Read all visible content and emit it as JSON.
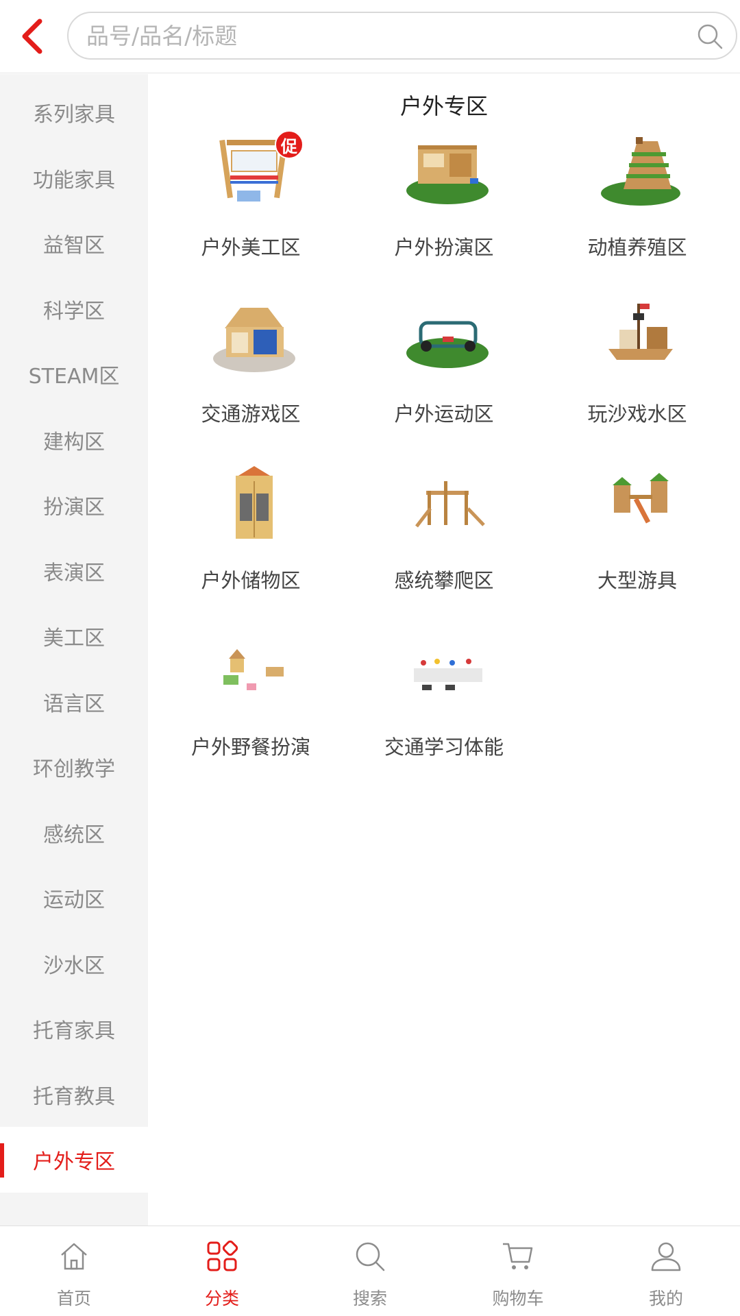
{
  "header": {
    "search_placeholder": "品号/品名/标题"
  },
  "sidebar": {
    "items": [
      {
        "label": "系列家具"
      },
      {
        "label": "功能家具"
      },
      {
        "label": "益智区"
      },
      {
        "label": "科学区"
      },
      {
        "label": "STEAM区"
      },
      {
        "label": "建构区"
      },
      {
        "label": "扮演区"
      },
      {
        "label": "表演区"
      },
      {
        "label": "美工区"
      },
      {
        "label": "语言区"
      },
      {
        "label": "环创教学"
      },
      {
        "label": "感统区"
      },
      {
        "label": "运动区"
      },
      {
        "label": "沙水区"
      },
      {
        "label": "托育家具"
      },
      {
        "label": "托育教具"
      },
      {
        "label": "户外专区"
      }
    ],
    "active_label": "户外专区"
  },
  "main": {
    "section_title": "户外专区",
    "promo_badge": "促",
    "categories": [
      {
        "label": "户外美工区",
        "icon": "outdoor-art-easel"
      },
      {
        "label": "户外扮演区",
        "icon": "outdoor-kitchen"
      },
      {
        "label": "动植养殖区",
        "icon": "planting-tower"
      },
      {
        "label": "交通游戏区",
        "icon": "traffic-house"
      },
      {
        "label": "户外运动区",
        "icon": "car-frame"
      },
      {
        "label": "玩沙戏水区",
        "icon": "pirate-ship"
      },
      {
        "label": "户外储物区",
        "icon": "storage-cabinet"
      },
      {
        "label": "感统攀爬区",
        "icon": "climbing-frame"
      },
      {
        "label": "大型游具",
        "icon": "playground"
      },
      {
        "label": "户外野餐扮演",
        "icon": "picnic-set"
      },
      {
        "label": "交通学习体能",
        "icon": "traffic-course"
      }
    ]
  },
  "tabbar": {
    "items": [
      {
        "label": "首页",
        "icon": "home-icon"
      },
      {
        "label": "分类",
        "icon": "category-icon"
      },
      {
        "label": "搜索",
        "icon": "search-icon"
      },
      {
        "label": "购物车",
        "icon": "cart-icon"
      },
      {
        "label": "我的",
        "icon": "user-icon"
      }
    ],
    "active_label": "分类"
  },
  "colors": {
    "accent": "#e31d1a",
    "sidebar_bg": "#f4f4f4",
    "text_muted": "#8a8a8a"
  }
}
